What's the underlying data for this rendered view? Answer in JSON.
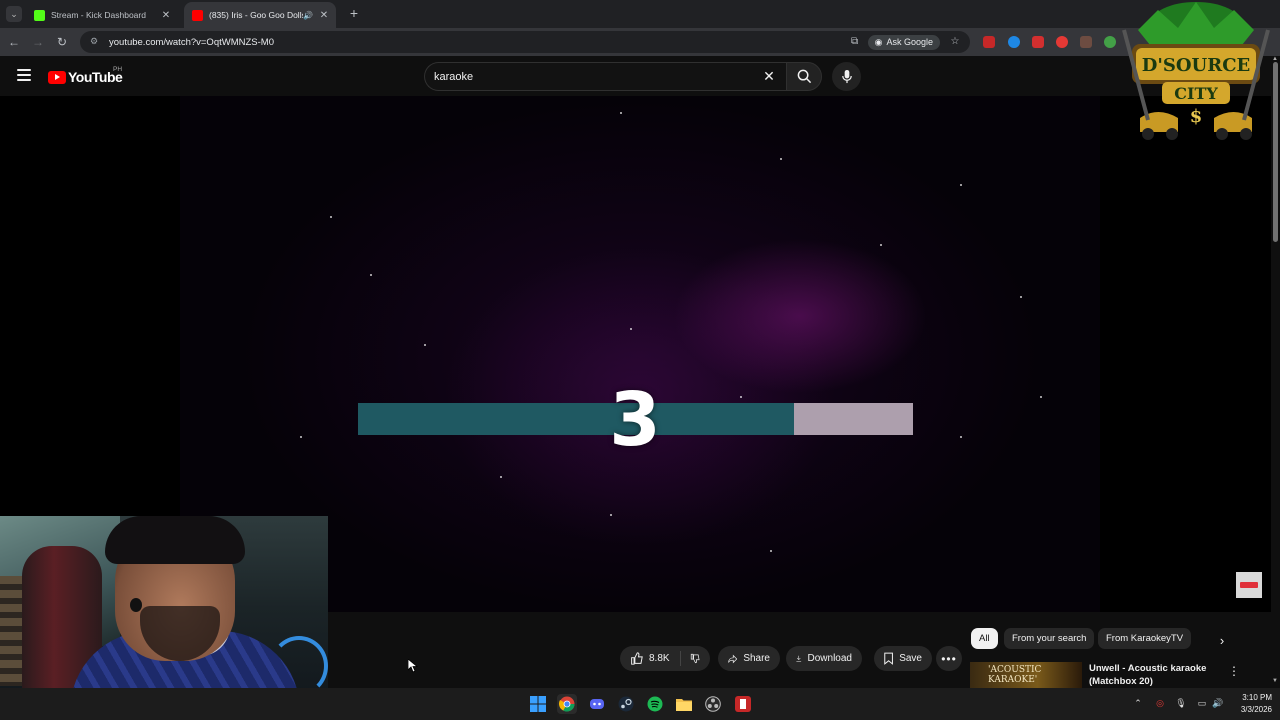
{
  "browser": {
    "tabs": [
      {
        "title": "Stream - Kick Dashboard",
        "active": false,
        "favicon_color": "#53fc18"
      },
      {
        "title": "(835) Iris - Goo Goo Dolls (L",
        "active": true,
        "favicon_color": "#ff0000"
      }
    ],
    "url": "youtube.com/watch?v=OqtWMNZS-M0",
    "ask_google_label": "Ask Google"
  },
  "youtube": {
    "logo_text": "YouTube",
    "region": "PH",
    "search": {
      "value": "karaoke"
    }
  },
  "player": {
    "countdown": "3",
    "progress_fraction": 0.785,
    "bar_fill_color": "#1f5962",
    "bar_track_color": "#ad9fad"
  },
  "actions": {
    "likes": "8.8K",
    "share": "Share",
    "download": "Download",
    "save": "Save"
  },
  "chips": [
    "All",
    "From your search",
    "From KaraokeyTV"
  ],
  "recommendation": {
    "thumb_text": "'ACOUSTIC KARAOKE'",
    "title": "Unwell - Acoustic karaoke (Matchbox 20)"
  },
  "overlay": {
    "logo_lines": [
      "D'SOURCE",
      "CITY",
      "$"
    ]
  },
  "taskbar": {
    "time": "3:10 PM",
    "date": "3/3/2026",
    "apps": [
      "windows-start",
      "chrome",
      "discord",
      "steam",
      "spotify",
      "file-explorer",
      "obs",
      "kick"
    ]
  }
}
